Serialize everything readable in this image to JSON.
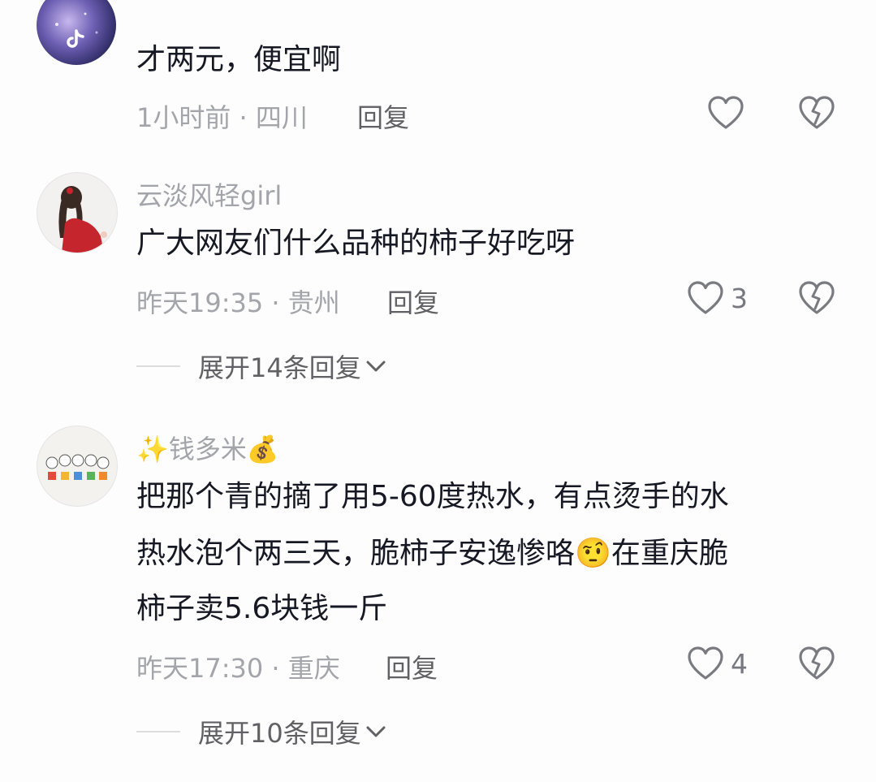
{
  "comments": [
    {
      "username": "",
      "text": "才两元，便宜啊",
      "time": "1小时前",
      "location": "四川",
      "reply_label": "回复",
      "likes": "",
      "avatar_icon": "tiktok-logo-icon"
    },
    {
      "username": "云淡风轻girl",
      "text": "广大网友们什么品种的柿子好吃呀",
      "time": "昨天19:35",
      "location": "贵州",
      "reply_label": "回复",
      "likes": "3",
      "expand_label": "展开14条回复",
      "avatar_icon": "girl-in-red-avatar"
    },
    {
      "username_prefix": "✨",
      "username": "钱多米",
      "username_suffix": "💰",
      "text_lines": [
        "把那个青的摘了用5-60度热水，有点烫手的水",
        "热水泡个两三天，脆柿子安逸惨咯",
        "在重庆脆",
        "柿子卖5.6块钱一斤"
      ],
      "emoji": "🤨",
      "time": "昨天17:30",
      "location": "重庆",
      "reply_label": "回复",
      "likes": "4",
      "expand_label": "展开10条回复",
      "avatar_icon": "cartoon-group-avatar"
    }
  ],
  "separator": " · ",
  "icons": {
    "like": "heart-outline-icon",
    "dislike": "broken-heart-icon",
    "expand": "chevron-down-icon"
  }
}
